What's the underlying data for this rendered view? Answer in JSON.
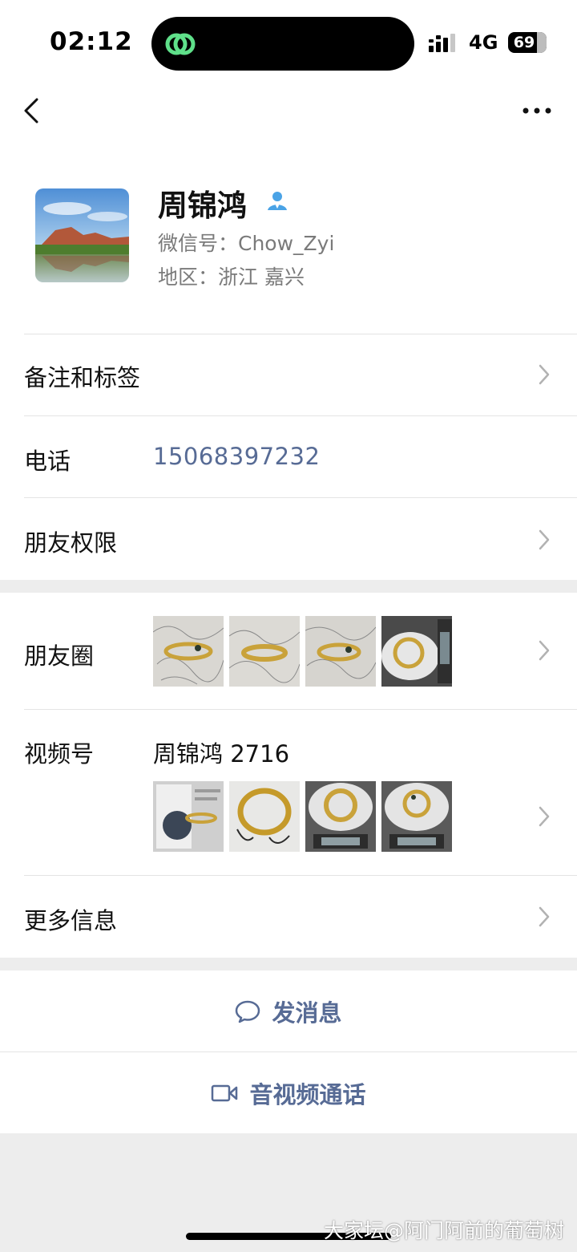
{
  "status_bar": {
    "time": "02:12",
    "network": "4G",
    "battery": "69"
  },
  "profile": {
    "name": "周锦鸿",
    "wechat_id": "微信号：Chow_Zyi",
    "region": "地区：浙江 嘉兴"
  },
  "rows": {
    "remarks_label": "备注和标签",
    "phone_label": "电话",
    "phone_value": "15068397232",
    "permissions_label": "朋友权限",
    "moments_label": "朋友圈",
    "channels_label": "视频号",
    "channels_value": "周锦鸿 2716",
    "more_info_label": "更多信息"
  },
  "actions": {
    "message_label": "发消息",
    "call_label": "音视频通话"
  },
  "watermark": "大家坛@阿门阿前的葡萄树",
  "colors": {
    "link": "#576b95",
    "background": "#ededed",
    "verify_icon": "#4aa3e6"
  },
  "icons": [
    "back-icon",
    "more-icon",
    "verified-user-icon",
    "chevron-right-icon",
    "chat-bubble-icon",
    "video-camera-icon"
  ]
}
